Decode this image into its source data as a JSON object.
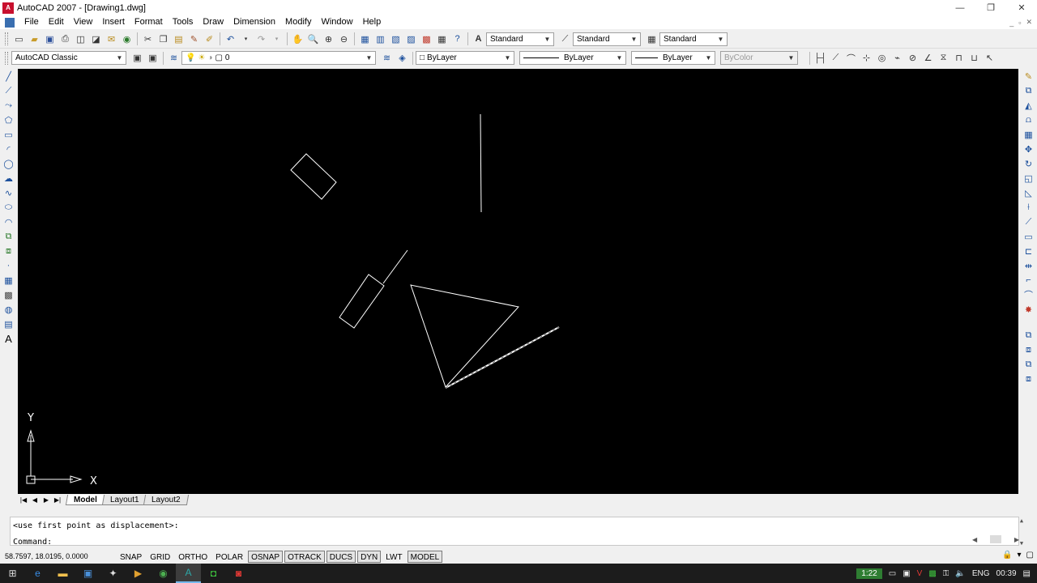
{
  "window": {
    "title": "AutoCAD 2007 - [Drawing1.dwg]",
    "app_icon_text": "A",
    "controls": {
      "minimize": "—",
      "restore": "❐",
      "close": "✕"
    },
    "mdi_controls": {
      "minimize": "_",
      "restore": "▫",
      "close": "✕"
    }
  },
  "menu": {
    "items": [
      "File",
      "Edit",
      "View",
      "Insert",
      "Format",
      "Tools",
      "Draw",
      "Dimension",
      "Modify",
      "Window",
      "Help"
    ]
  },
  "toolbar_standard": {
    "text_style": "Standard",
    "dim_style": "Standard",
    "table_style": "Standard"
  },
  "toolbar_layers": {
    "workspace": "AutoCAD Classic",
    "layer": "0",
    "color": "ByLayer",
    "linetype": "ByLayer",
    "lineweight": "ByLayer",
    "plotstyle": "ByColor"
  },
  "left_tool_icons": [
    "line-icon",
    "construction-line-icon",
    "polyline-icon",
    "polygon-icon",
    "rectangle-icon",
    "arc-icon",
    "circle-icon",
    "revision-cloud-icon",
    "spline-icon",
    "ellipse-icon",
    "ellipse-arc-icon",
    "insert-block-icon",
    "make-block-icon",
    "point-icon",
    "hatch-icon",
    "gradient-icon",
    "region-icon",
    "table-icon",
    "multiline-text-icon"
  ],
  "left_text_tool": "A",
  "right_tool_icons": [
    "erase-icon",
    "copy-icon",
    "mirror-icon",
    "offset-icon",
    "array-icon",
    "move-icon",
    "rotate-icon",
    "scale-icon",
    "stretch-icon",
    "trim-icon",
    "extend-icon",
    "break-at-point-icon",
    "break-icon",
    "join-icon",
    "chamfer-icon",
    "fillet-icon",
    "explode-icon",
    "draw-order-front-icon",
    "draw-order-back-icon",
    "draw-order-above-icon",
    "draw-order-under-icon"
  ],
  "ucs": {
    "x_label": "X",
    "y_label": "Y"
  },
  "layout_tabs": [
    {
      "label": "Model",
      "active": true
    },
    {
      "label": "Layout1",
      "active": false
    },
    {
      "label": "Layout2",
      "active": false
    }
  ],
  "command": {
    "history": "<use first point as displacement>:",
    "prompt": "Command:"
  },
  "status": {
    "coordinates": "58.7597, 18.0195, 0.0000",
    "toggles": [
      {
        "label": "SNAP",
        "on": false
      },
      {
        "label": "GRID",
        "on": false
      },
      {
        "label": "ORTHO",
        "on": false
      },
      {
        "label": "POLAR",
        "on": false
      },
      {
        "label": "OSNAP",
        "on": true
      },
      {
        "label": "OTRACK",
        "on": true
      },
      {
        "label": "DUCS",
        "on": true
      },
      {
        "label": "DYN",
        "on": true
      },
      {
        "label": "LWT",
        "on": false
      },
      {
        "label": "MODEL",
        "on": true
      }
    ]
  },
  "taskbar": {
    "apps": [
      "windows-start-icon",
      "edge-icon",
      "file-explorer-icon",
      "powerpoint-icon",
      "tools-icon",
      "media-icon",
      "chrome-icon",
      "autocad-icon",
      "camtasia-icon",
      "recorder-icon"
    ],
    "recording_time": "1:22",
    "language": "ENG",
    "clock": "00:39"
  },
  "colors": {
    "canvas": "#000000",
    "geometry": "#ffffff",
    "selection_accent": "#76b9ed"
  }
}
